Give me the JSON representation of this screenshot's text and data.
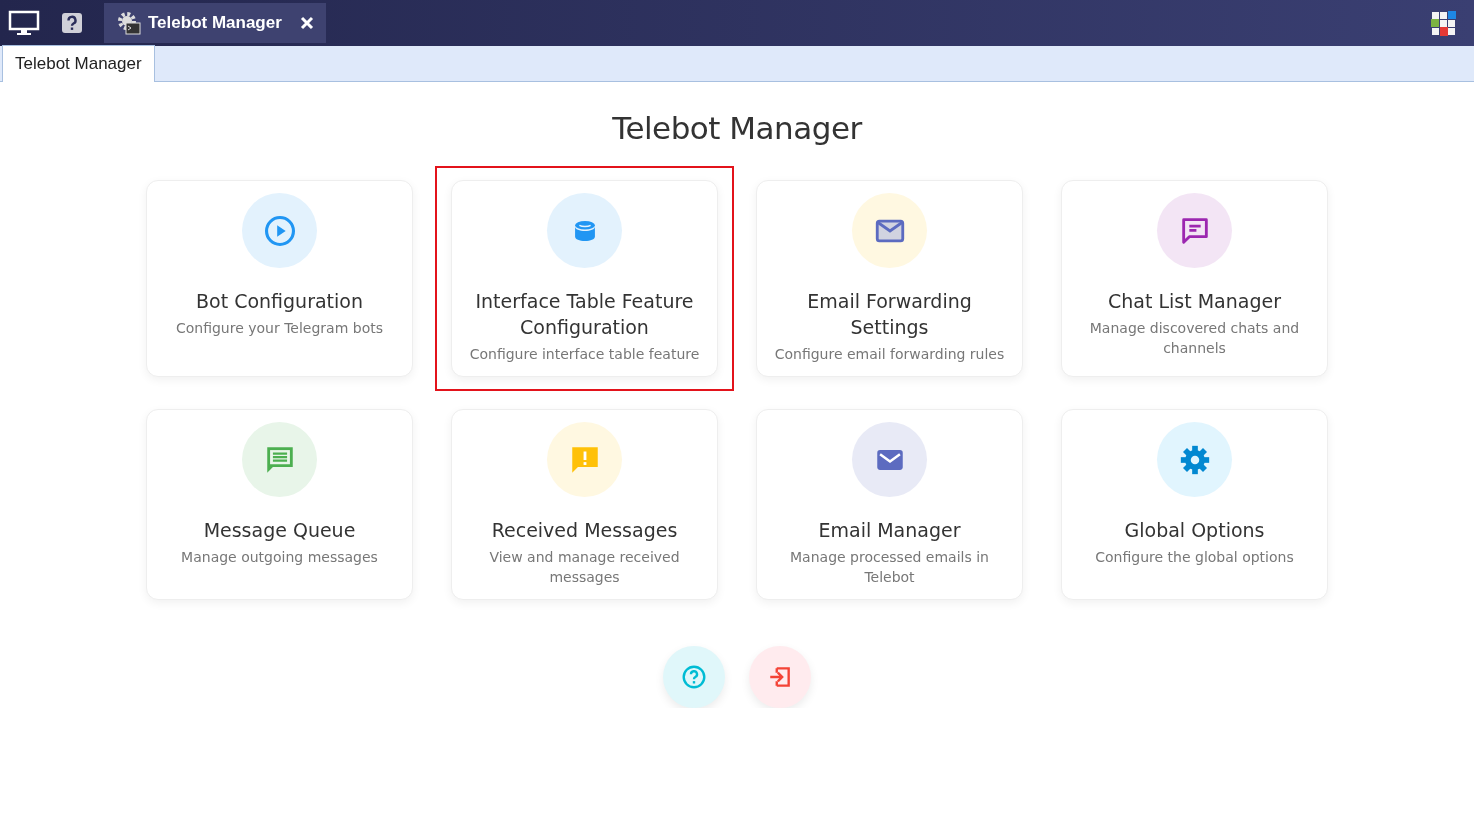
{
  "top_bar": {
    "app_tab": {
      "title": "Telebot Manager",
      "selected": true
    }
  },
  "tabs": [
    {
      "label": "Telebot Manager",
      "selected": true
    }
  ],
  "page": {
    "title": "Telebot Manager"
  },
  "cards": [
    {
      "kind": "play",
      "color": "#2196f3",
      "title": "Bot Configuration",
      "description": "Configure your Telegram bots",
      "highlighted": false
    },
    {
      "kind": "database",
      "color": "#2196f3",
      "title": "Interface Table Feature Configuration",
      "description": "Configure interface table feature",
      "highlighted": true
    },
    {
      "kind": "mail-outline",
      "color": "#5c6bc0",
      "title": "Email Forwarding Settings",
      "description": "Configure email forwarding rules",
      "highlighted": false
    },
    {
      "kind": "chat-outline",
      "color": "#9c27b0",
      "title": "Chat List Manager",
      "description": "Manage discovered chats and channels",
      "highlighted": false
    },
    {
      "kind": "chat-list",
      "color": "#4caf50",
      "title": "Message Queue",
      "description": "Manage outgoing messages",
      "highlighted": false
    },
    {
      "kind": "chat-alert",
      "color": "#ffc107",
      "title": "Received Messages",
      "description": "View and manage received messages",
      "highlighted": false
    },
    {
      "kind": "mail",
      "color": "#5c6bc0",
      "title": "Email Manager",
      "description": "Manage processed emails in Telebot",
      "highlighted": false
    },
    {
      "kind": "gear",
      "color": "#0288d1",
      "title": "Global Options",
      "description": "Configure the global options",
      "highlighted": false
    }
  ],
  "actions": [
    {
      "kind": "help"
    },
    {
      "kind": "logout"
    }
  ]
}
